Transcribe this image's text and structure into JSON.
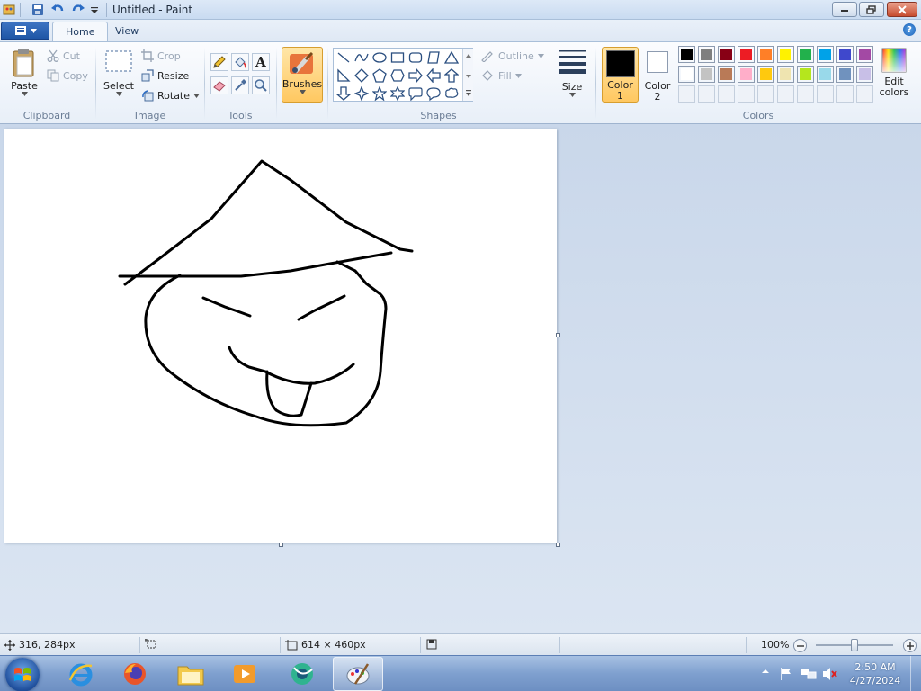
{
  "title_bar": {
    "title": "Untitled - Paint"
  },
  "tabs": [
    {
      "label": "Home",
      "active": true
    },
    {
      "label": "View",
      "active": false
    }
  ],
  "ribbon": {
    "clipboard": {
      "group_label": "Clipboard",
      "paste": "Paste",
      "cut": "Cut",
      "copy": "Copy"
    },
    "image": {
      "group_label": "Image",
      "select": "Select",
      "crop": "Crop",
      "resize": "Resize",
      "rotate": "Rotate"
    },
    "tools": {
      "group_label": "Tools",
      "text_tool": "A"
    },
    "brushes": {
      "label": "Brushes"
    },
    "shapes": {
      "group_label": "Shapes",
      "outline": "Outline",
      "fill": "Fill"
    },
    "size": {
      "label": "Size"
    },
    "colors": {
      "group_label": "Colors",
      "color1_label": "Color\n1",
      "color1_line1": "Color",
      "color1_line2": "1",
      "color2_line1": "Color",
      "color2_line2": "2",
      "color1_value": "#000000",
      "color2_value": "#ffffff",
      "edit_line1": "Edit",
      "edit_line2": "colors",
      "palette_row1": [
        "#000000",
        "#7f7f7f",
        "#880015",
        "#ed1c24",
        "#ff7f27",
        "#fff200",
        "#22b14c",
        "#00a2e8",
        "#3f48cc",
        "#a349a4"
      ],
      "palette_row2": [
        "#ffffff",
        "#c3c3c3",
        "#b97a57",
        "#ffaec9",
        "#ffc90e",
        "#efe4b0",
        "#b5e61d",
        "#99d9ea",
        "#7092be",
        "#c8bfe7"
      ]
    }
  },
  "status_bar": {
    "cursor_position": "316, 284px",
    "canvas_size": "614 × 460px",
    "zoom": "100%",
    "zoom_level": 1.0
  },
  "taskbar": {
    "time": "2:50 AM",
    "date": "4/27/2024"
  }
}
